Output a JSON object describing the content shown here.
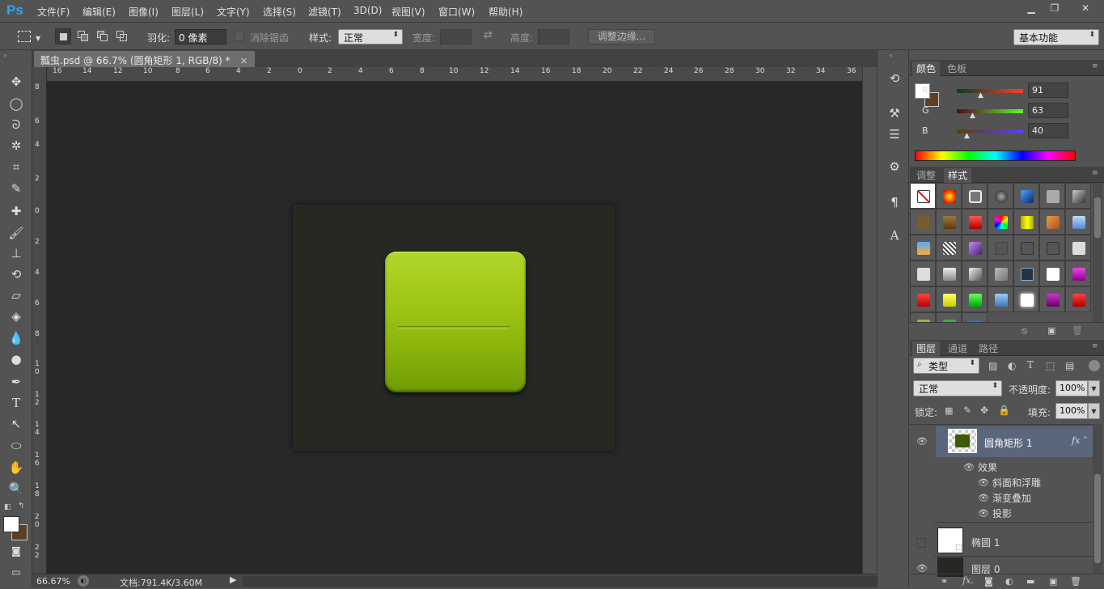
{
  "app": {
    "logo": "Ps"
  },
  "menu": [
    "文件(F)",
    "编辑(E)",
    "图像(I)",
    "图层(L)",
    "文字(Y)",
    "选择(S)",
    "滤镜(T)",
    "3D(D)",
    "视图(V)",
    "窗口(W)",
    "帮助(H)"
  ],
  "window_controls": {
    "minimize": "▁",
    "restore": "❐",
    "close": "✕"
  },
  "options": {
    "feather_label": "羽化:",
    "feather_value": "0 像素",
    "antialias_label": "消除锯齿",
    "style_label": "样式:",
    "style_value": "正常",
    "width_label": "宽度:",
    "height_label": "高度:",
    "refine_edge": "调整边缘...",
    "workspace": "基本功能"
  },
  "document": {
    "tab_title": "瓢虫.psd @ 66.7% (圆角矩形 1, RGB/8) *",
    "close": "×",
    "canvas_color": "#262922",
    "button_color": "#9dc514"
  },
  "ruler": {
    "h_ticks": [
      "16",
      "14",
      "12",
      "10",
      "8",
      "6",
      "4",
      "2",
      "0",
      "2",
      "4",
      "6",
      "8",
      "10",
      "12",
      "14",
      "16",
      "18",
      "20",
      "22",
      "24",
      "26",
      "28",
      "30",
      "32",
      "34",
      "36"
    ],
    "v_ticks": [
      "8",
      "6",
      "4",
      "2",
      "0",
      "2",
      "4",
      "6",
      "8",
      "1 0",
      "1 2",
      "1 4",
      "1 6",
      "1 8",
      "2 0",
      "2 2"
    ]
  },
  "status": {
    "zoom": "66.67%",
    "doc_info": "文档:791.4K/3.60M"
  },
  "color_panel": {
    "tabs": [
      "颜色",
      "色板"
    ],
    "channels": [
      {
        "label": "R",
        "value": "91"
      },
      {
        "label": "G",
        "value": "63"
      },
      {
        "label": "B",
        "value": "40"
      }
    ],
    "foreground": "#ffffff",
    "background": "#5b3f28"
  },
  "styles_panel": {
    "tabs": [
      "调整",
      "样式"
    ]
  },
  "layers_panel": {
    "tabs": [
      "图层",
      "通道",
      "路径"
    ],
    "filter_label": "类型",
    "blend_mode": "正常",
    "opacity_label": "不透明度:",
    "opacity_value": "100%",
    "lock_label": "锁定:",
    "fill_label": "填充:",
    "fill_value": "100%",
    "layers": [
      {
        "name": "圆角矩形 1",
        "fx": "fx",
        "selected": true
      },
      {
        "name": "椭圆 1",
        "selected": false
      },
      {
        "name": "图层 0",
        "selected": false
      }
    ],
    "effects_label": "效果",
    "effects": [
      "斜面和浮雕",
      "渐变叠加",
      "投影"
    ]
  }
}
